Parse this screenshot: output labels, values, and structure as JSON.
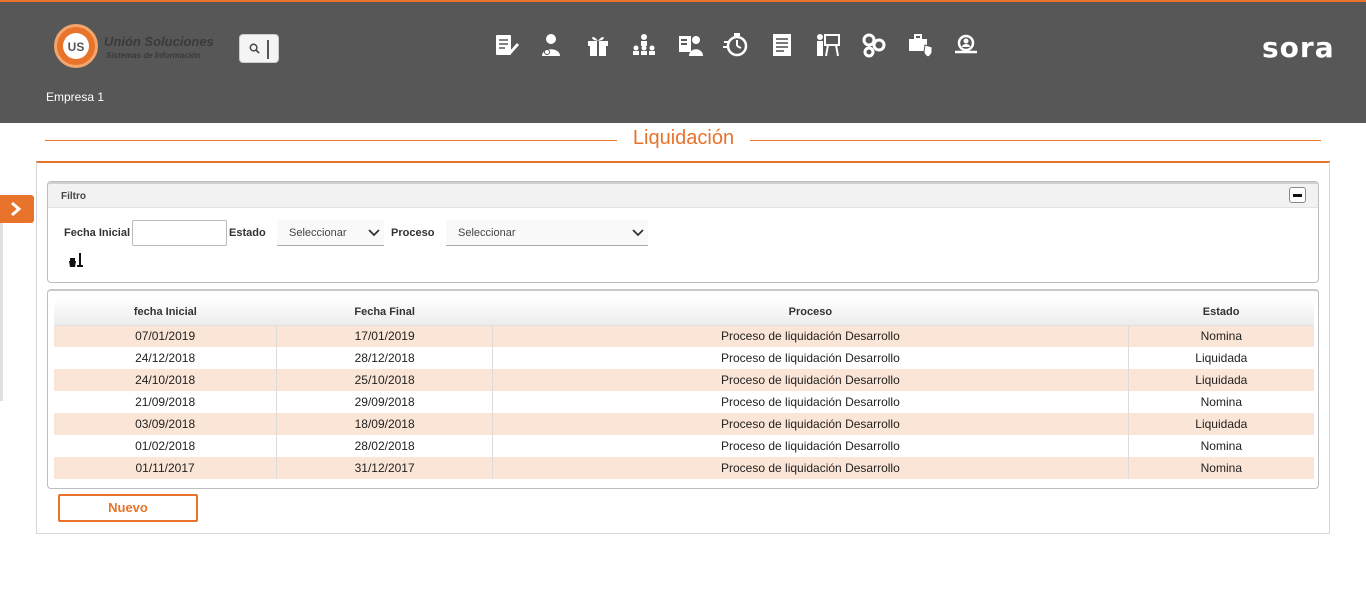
{
  "header": {
    "logo": {
      "name": "Unión Soluciones",
      "tagline": "Sistemas de Información",
      "badge": "US"
    },
    "brand": "sora",
    "company": "Empresa 1",
    "nav_icons": [
      "document-edit-icon",
      "user-money-icon",
      "gift-icon",
      "hierarchy-icon",
      "user-id-card-icon",
      "timer-icon",
      "report-list-icon",
      "presentation-icon",
      "settings-gears-icon",
      "briefcase-shield-icon",
      "user-search-icon"
    ],
    "accent_color": "#e8732a",
    "header_color": "#575757"
  },
  "page": {
    "title": "Liquidación"
  },
  "filter": {
    "title": "Filtro",
    "fecha_inicial_label": "Fecha Inicial",
    "fecha_inicial_value": "",
    "estado_label": "Estado",
    "estado_selected": "Seleccionar",
    "proceso_label": "Proceso",
    "proceso_selected": "Seleccionar"
  },
  "table": {
    "columns": [
      "fecha Inicial",
      "Fecha Final",
      "Proceso",
      "Estado"
    ],
    "rows": [
      [
        "07/01/2019",
        "17/01/2019",
        "Proceso de liquidación Desarrollo",
        "Nomina"
      ],
      [
        "24/12/2018",
        "28/12/2018",
        "Proceso de liquidación Desarrollo",
        "Liquidada"
      ],
      [
        "24/10/2018",
        "25/10/2018",
        "Proceso de liquidación Desarrollo",
        "Liquidada"
      ],
      [
        "21/09/2018",
        "29/09/2018",
        "Proceso de liquidación Desarrollo",
        "Nomina"
      ],
      [
        "03/09/2018",
        "18/09/2018",
        "Proceso de liquidación Desarrollo",
        "Liquidada"
      ],
      [
        "01/02/2018",
        "28/02/2018",
        "Proceso de liquidación Desarrollo",
        "Nomina"
      ],
      [
        "01/11/2017",
        "31/12/2017",
        "Proceso de liquidación Desarrollo",
        "Nomina"
      ]
    ]
  },
  "actions": {
    "new_label": "Nuevo"
  }
}
